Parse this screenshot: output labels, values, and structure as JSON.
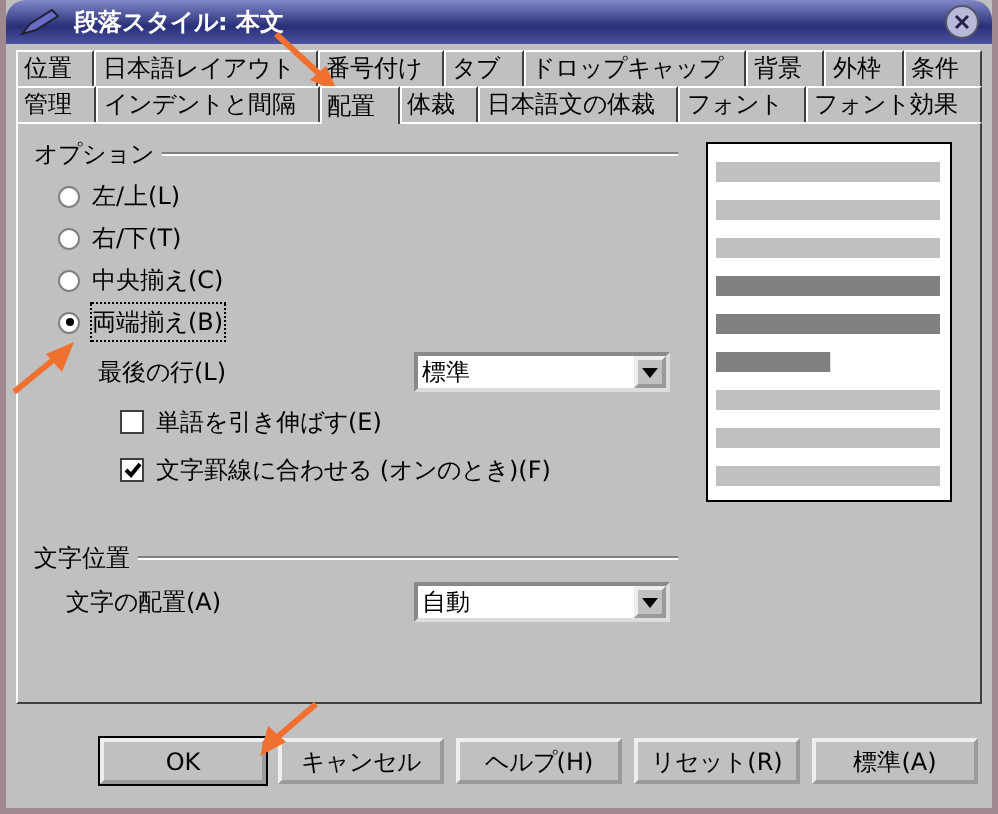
{
  "window": {
    "title": "段落スタイル: 本文"
  },
  "tab_rows": [
    [
      {
        "label": "位置",
        "selected": false
      },
      {
        "label": "日本語レイアウト",
        "selected": false
      },
      {
        "label": "番号付け",
        "selected": false
      },
      {
        "label": "タブ",
        "selected": false
      },
      {
        "label": "ドロップキャップ",
        "selected": false
      },
      {
        "label": "背景",
        "selected": false
      },
      {
        "label": "外枠",
        "selected": false
      },
      {
        "label": "条件",
        "selected": false
      }
    ],
    [
      {
        "label": "管理",
        "selected": false
      },
      {
        "label": "インデントと間隔",
        "selected": false
      },
      {
        "label": "配置",
        "selected": true
      },
      {
        "label": "体裁",
        "selected": false
      },
      {
        "label": "日本語文の体裁",
        "selected": false
      },
      {
        "label": "フォント",
        "selected": false
      },
      {
        "label": "フォント効果",
        "selected": false
      }
    ]
  ],
  "options": {
    "title": "オプション",
    "radios": [
      {
        "label": "左/上(L)",
        "selected": false
      },
      {
        "label": "右/下(T)",
        "selected": false
      },
      {
        "label": "中央揃え(C)",
        "selected": false
      },
      {
        "label": "両端揃え(B)",
        "selected": true
      }
    ],
    "last_line": {
      "label": "最後の行(L)",
      "value": "標準"
    },
    "checkboxes": [
      {
        "label": "単語を引き伸ばす(E)",
        "checked": false
      },
      {
        "label": "文字罫線に合わせる (オンのとき)(F)",
        "checked": true
      }
    ]
  },
  "text_position": {
    "title": "文字位置",
    "label": "文字の配置(A)",
    "value": "自動"
  },
  "buttons": [
    {
      "label": "OK",
      "default": true
    },
    {
      "label": "キャンセル",
      "default": false
    },
    {
      "label": "ヘルプ(H)",
      "default": false
    },
    {
      "label": "リセット(R)",
      "default": false
    },
    {
      "label": "標準(A)",
      "default": false
    }
  ]
}
